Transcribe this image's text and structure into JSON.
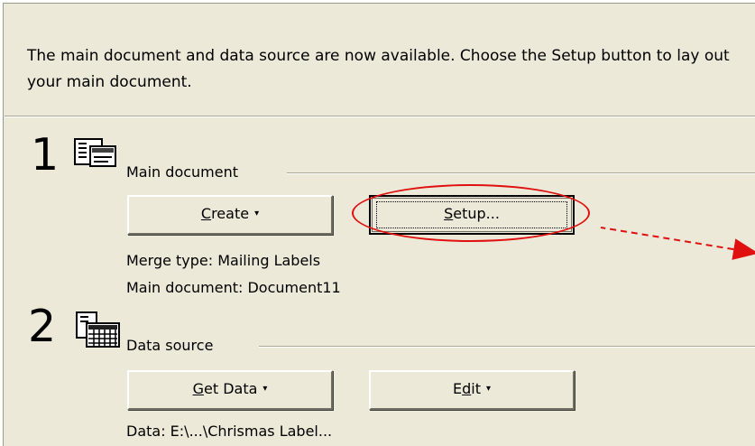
{
  "instructions": "The main document and data source are now available. Choose the Setup button to lay out your main document.",
  "step1": {
    "number": "1",
    "icon": "main-document-icon",
    "label": "Main document",
    "create_button": {
      "pre": "",
      "mnemonic": "C",
      "post": "reate",
      "arrow": "▾"
    },
    "setup_button": {
      "pre": "",
      "mnemonic": "S",
      "post": "etup..."
    },
    "merge_type": "Merge type: Mailing Labels",
    "main_document": "Main document: Document11"
  },
  "step2": {
    "number": "2",
    "icon": "data-source-icon",
    "label": "Data source",
    "getdata_button": {
      "pre": "",
      "mnemonic": "G",
      "post": "et Data",
      "arrow": "▾"
    },
    "edit_button": {
      "pre": "E",
      "mnemonic": "d",
      "post": "it",
      "arrow": "▾"
    },
    "data": "Data: E:\\...\\Chrismas Label..."
  },
  "annotation": {
    "color": "#e01010"
  }
}
